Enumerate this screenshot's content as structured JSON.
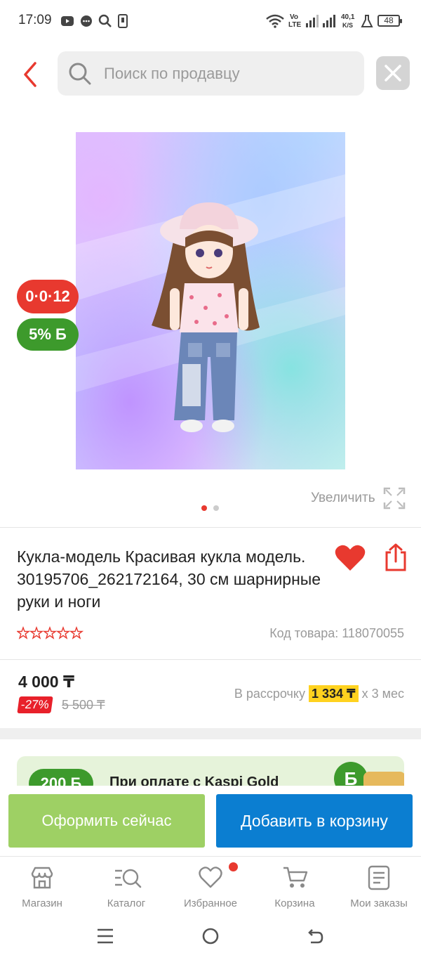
{
  "status_bar": {
    "time": "17:09",
    "net_top": "Vo",
    "net_bottom": "LTE",
    "speed_top": "40,1",
    "speed_bottom": "K/S",
    "battery": "48"
  },
  "search": {
    "placeholder": "Поиск по продавцу"
  },
  "product": {
    "timer_badge": "0·0·12",
    "bonus_badge": "5% Б",
    "zoom_label": "Увеличить",
    "gallery": {
      "total": 2,
      "active": 1
    },
    "title": "Кукла-модель Красивая кукла модель. 30195706_262172164, 30 см шарнирные руки и ноги",
    "rating_stars": 0,
    "code_label": "Код товара: 118070055",
    "price": "4 000 ₸",
    "discount": "-27%",
    "old_price": "5 500 ₸",
    "installment_prefix": "В рассрочку",
    "installment_amount": "1 334 ₸",
    "installment_suffix": "х 3 мес"
  },
  "promo": {
    "badge": "200 Б",
    "text": "При оплате с Kaspi Gold",
    "coin": "Б"
  },
  "actions": {
    "buy_now": "Оформить сейчас",
    "add_to_cart": "Добавить в корзину"
  },
  "bottom_nav": {
    "items": [
      {
        "label": "Магазин"
      },
      {
        "label": "Каталог"
      },
      {
        "label": "Избранное"
      },
      {
        "label": "Корзина"
      },
      {
        "label": "Мои заказы"
      }
    ]
  },
  "colors": {
    "accent_red": "#e8392f",
    "bonus_green": "#3d9a2c",
    "buy_green": "#9ed064",
    "cart_blue": "#0b7ed1",
    "installment_yellow": "#ffd21f"
  }
}
